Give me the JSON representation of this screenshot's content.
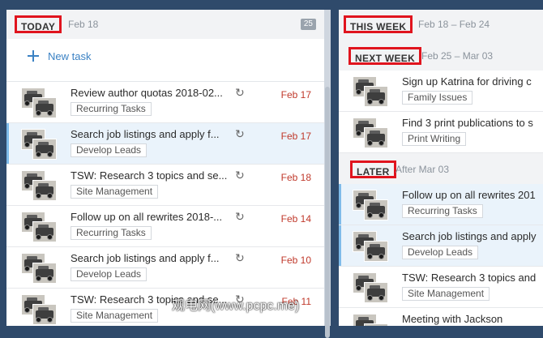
{
  "today": {
    "title": "TODAY",
    "date": "Feb 18",
    "count": "25",
    "new_task": "New task",
    "tasks": [
      {
        "title": "Review author quotas 2018-02...",
        "tag": "Recurring Tasks",
        "date": "Feb 17"
      },
      {
        "title": "Search job listings and apply f...",
        "tag": "Develop Leads",
        "date": "Feb 17"
      },
      {
        "title": "TSW: Research 3 topics and se...",
        "tag": "Site Management",
        "date": "Feb 18"
      },
      {
        "title": "Follow up on all rewrites 2018-...",
        "tag": "Recurring Tasks",
        "date": "Feb 14"
      },
      {
        "title": "Search job listings and apply f...",
        "tag": "Develop Leads",
        "date": "Feb 10"
      },
      {
        "title": "TSW: Research 3 topics and se...",
        "tag": "Site Management",
        "date": "Feb 11"
      }
    ]
  },
  "this_week": {
    "title": "THIS WEEK",
    "date": "Feb 18 – Feb 24"
  },
  "next_week": {
    "title": "NEXT WEEK",
    "date": "Feb 25 – Mar 03",
    "tasks": [
      {
        "title": "Sign up Katrina for driving c",
        "tag": "Family Issues"
      },
      {
        "title": "Find 3 print publications to s",
        "tag": "Print Writing"
      }
    ]
  },
  "later": {
    "title": "LATER",
    "date": "After Mar 03",
    "tasks": [
      {
        "title": "Follow up on all rewrites 201",
        "tag": "Recurring Tasks"
      },
      {
        "title": "Search job listings and apply",
        "tag": "Develop Leads"
      },
      {
        "title": "TSW: Research 3 topics and",
        "tag": "Site Management"
      },
      {
        "title": "Meeting with Jackson",
        "tag": ""
      }
    ]
  },
  "icons": {
    "add": "plus-icon",
    "recurring": "refresh-icon",
    "avatar": "jeep-photo"
  },
  "colors": {
    "accent": "#3b82c4",
    "overdue": "#c0392b",
    "highlight": "#eaf3fb",
    "annotation": "#e0141e"
  },
  "watermark": "观电网(www.pcpc.me)"
}
